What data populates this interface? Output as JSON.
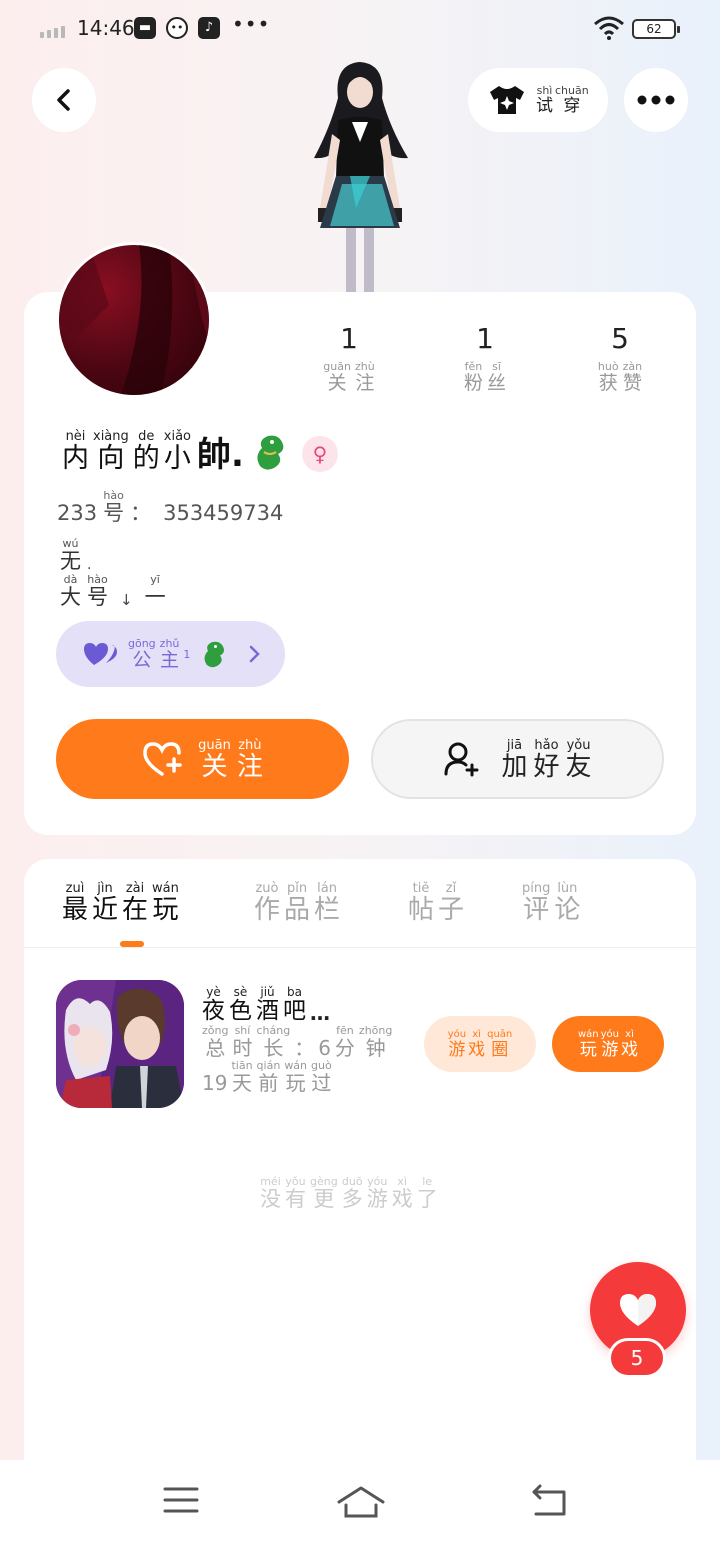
{
  "status_bar": {
    "time": "14:46",
    "battery": "62",
    "app_icons": [
      "bag-icon",
      "cat-icon",
      "music-icon"
    ],
    "more": "•••"
  },
  "top_bar": {
    "try_on": {
      "chars": [
        {
          "py": "shì",
          "hz": "试"
        },
        {
          "py": "chuān",
          "hz": "穿"
        }
      ]
    }
  },
  "stats": [
    {
      "num": "1",
      "chars": [
        {
          "py": "guān",
          "hz": "关"
        },
        {
          "py": "zhù",
          "hz": "注"
        }
      ]
    },
    {
      "num": "1",
      "chars": [
        {
          "py": "fěn",
          "hz": "粉"
        },
        {
          "py": "sī",
          "hz": "丝"
        }
      ]
    },
    {
      "num": "5",
      "chars": [
        {
          "py": "huò",
          "hz": "获"
        },
        {
          "py": "zàn",
          "hz": "赞"
        }
      ]
    }
  ],
  "name": {
    "chars": [
      {
        "py": "nèi",
        "hz": "内"
      },
      {
        "py": "xiàng",
        "hz": "向"
      },
      {
        "py": "de",
        "hz": "的"
      },
      {
        "py": "xiǎo",
        "hz": "小"
      }
    ],
    "big": "帥.",
    "gender_symbol": "♀"
  },
  "account_id": {
    "prefix_num": "233",
    "hao": {
      "py": "hào",
      "hz": "号"
    },
    "colon": "：",
    "value": "353459734"
  },
  "bio": {
    "line1": {
      "chars": [
        {
          "py": "wú",
          "hz": "无"
        }
      ],
      "suffix": "."
    },
    "line2": {
      "chars": [
        {
          "py": "dà",
          "hz": "大"
        },
        {
          "py": "hào",
          "hz": "号"
        }
      ],
      "arrow": "↓",
      "tail": {
        "py": "yī",
        "hz": "一"
      }
    }
  },
  "title_badge": {
    "chars": [
      {
        "py": "gōng",
        "hz": "公"
      },
      {
        "py": "zhǔ",
        "hz": "主"
      }
    ],
    "sup": "1"
  },
  "actions": {
    "follow": {
      "chars": [
        {
          "py": "guān",
          "hz": "关"
        },
        {
          "py": "zhù",
          "hz": "注"
        }
      ]
    },
    "add_friend": {
      "chars": [
        {
          "py": "jiā",
          "hz": "加"
        },
        {
          "py": "hǎo",
          "hz": "好"
        },
        {
          "py": "yǒu",
          "hz": "友"
        }
      ]
    }
  },
  "tabs": [
    {
      "chars": [
        {
          "py": "zuì",
          "hz": "最"
        },
        {
          "py": "jìn",
          "hz": "近"
        },
        {
          "py": "zài",
          "hz": "在"
        },
        {
          "py": "wán",
          "hz": "玩"
        }
      ]
    },
    {
      "chars": [
        {
          "py": "zuò",
          "hz": "作"
        },
        {
          "py": "pǐn",
          "hz": "品"
        },
        {
          "py": "lán",
          "hz": "栏"
        }
      ]
    },
    {
      "chars": [
        {
          "py": "tiě",
          "hz": "帖"
        },
        {
          "py": "zǐ",
          "hz": "子"
        }
      ]
    },
    {
      "chars": [
        {
          "py": "píng",
          "hz": "评"
        },
        {
          "py": "lùn",
          "hz": "论"
        }
      ]
    }
  ],
  "game": {
    "title_chars": [
      {
        "py": "yè",
        "hz": "夜"
      },
      {
        "py": "sè",
        "hz": "色"
      },
      {
        "py": "jiǔ",
        "hz": "酒"
      },
      {
        "py": "ba",
        "hz": "吧"
      }
    ],
    "title_ellipsis": "…",
    "duration_chars": [
      {
        "py": "zǒng",
        "hz": "总"
      },
      {
        "py": "shí",
        "hz": "时"
      },
      {
        "py": "cháng",
        "hz": "长"
      }
    ],
    "duration_colon": "：",
    "duration_num": "6",
    "duration_unit": [
      {
        "py": "fēn",
        "hz": "分"
      },
      {
        "py": "zhōng",
        "hz": "钟"
      }
    ],
    "last_played_num": "19",
    "last_played_chars": [
      {
        "py": "tiān",
        "hz": "天"
      },
      {
        "py": "qián",
        "hz": "前"
      },
      {
        "py": "wán",
        "hz": "玩"
      },
      {
        "py": "guò",
        "hz": "过"
      }
    ],
    "circle_btn": [
      {
        "py": "yóu",
        "hz": "游"
      },
      {
        "py": "xì",
        "hz": "戏"
      },
      {
        "py": "quān",
        "hz": "圈"
      }
    ],
    "play_btn": [
      {
        "py": "wán",
        "hz": "玩"
      },
      {
        "py": "yóu",
        "hz": "游"
      },
      {
        "py": "xì",
        "hz": "戏"
      }
    ]
  },
  "no_more": [
    {
      "py": "méi",
      "hz": "没"
    },
    {
      "py": "yǒu",
      "hz": "有"
    },
    {
      "py": "gèng",
      "hz": "更"
    },
    {
      "py": "duō",
      "hz": "多"
    },
    {
      "py": "yóu",
      "hz": "游"
    },
    {
      "py": "xì",
      "hz": "戏"
    },
    {
      "py": "le",
      "hz": "了"
    }
  ],
  "like_fab": {
    "count": "5"
  },
  "colors": {
    "accent": "#ff7a1a",
    "like": "#f43a3a",
    "badge": "#7b6ad6",
    "badge_bg": "#e4e0f8"
  }
}
